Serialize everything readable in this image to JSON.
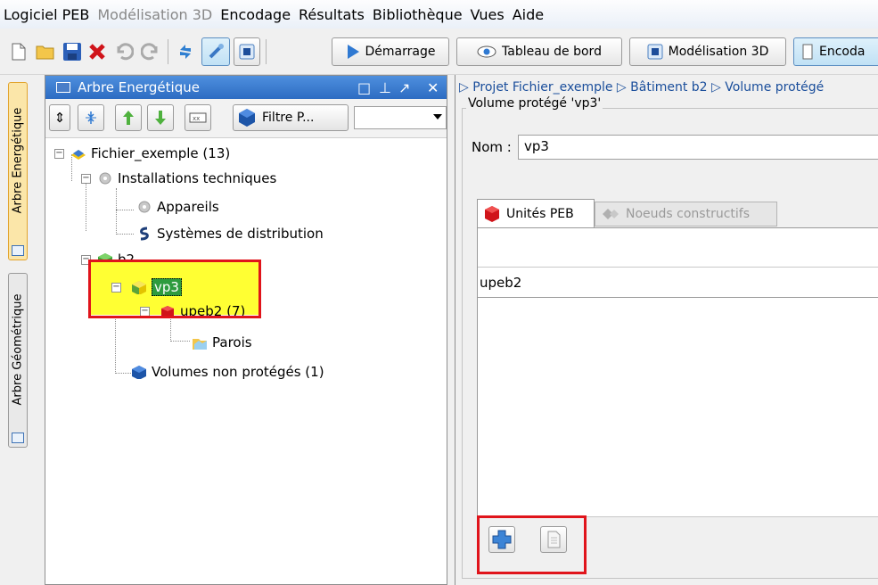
{
  "menubar": {
    "items": [
      {
        "label": "Logiciel PEB",
        "disabled": false
      },
      {
        "label": "Modélisation 3D",
        "disabled": true
      },
      {
        "label": "Encodage",
        "disabled": false
      },
      {
        "label": "Résultats",
        "disabled": false
      },
      {
        "label": "Bibliothèque",
        "disabled": false
      },
      {
        "label": "Vues",
        "disabled": false
      },
      {
        "label": "Aide",
        "disabled": false
      }
    ]
  },
  "toolbar": {
    "demarrage": "Démarrage",
    "tableau_de_bord": "Tableau de bord",
    "modelisation_3d": "Modélisation 3D",
    "encodage": "Encoda"
  },
  "side_tabs": {
    "energetique": "Arbre Energétique",
    "geometrique": "Arbre Géométrique"
  },
  "tree_panel": {
    "title": "Arbre Energétique",
    "filter_label": "Filtre P...",
    "filter_value": "",
    "nodes": {
      "root": "Fichier_exemple (13)",
      "installations": "Installations techniques",
      "appareils": "Appareils",
      "systemes": "Systèmes de distribution",
      "b2": "b2",
      "vp3": "vp3",
      "upeb2": "upeb2 (7)",
      "parois": "Parois",
      "volumes_non": "Volumes non protégés (1)"
    }
  },
  "right_panel": {
    "breadcrumb": "▷ Projet Fichier_exemple ▷ Bâtiment b2 ▷ Volume protégé",
    "group_title": "Volume protégé 'vp3'",
    "name_label": "Nom :",
    "name_value": "vp3",
    "tabs": [
      "Unités PEB",
      "Noeuds constructifs"
    ],
    "table_rows": [
      "upeb2"
    ]
  },
  "colors": {
    "title_bar": "#2d6cc2",
    "highlight": "#ffff33",
    "annotation_red": "#e0141b",
    "tab_active": "#fbe6a9"
  }
}
